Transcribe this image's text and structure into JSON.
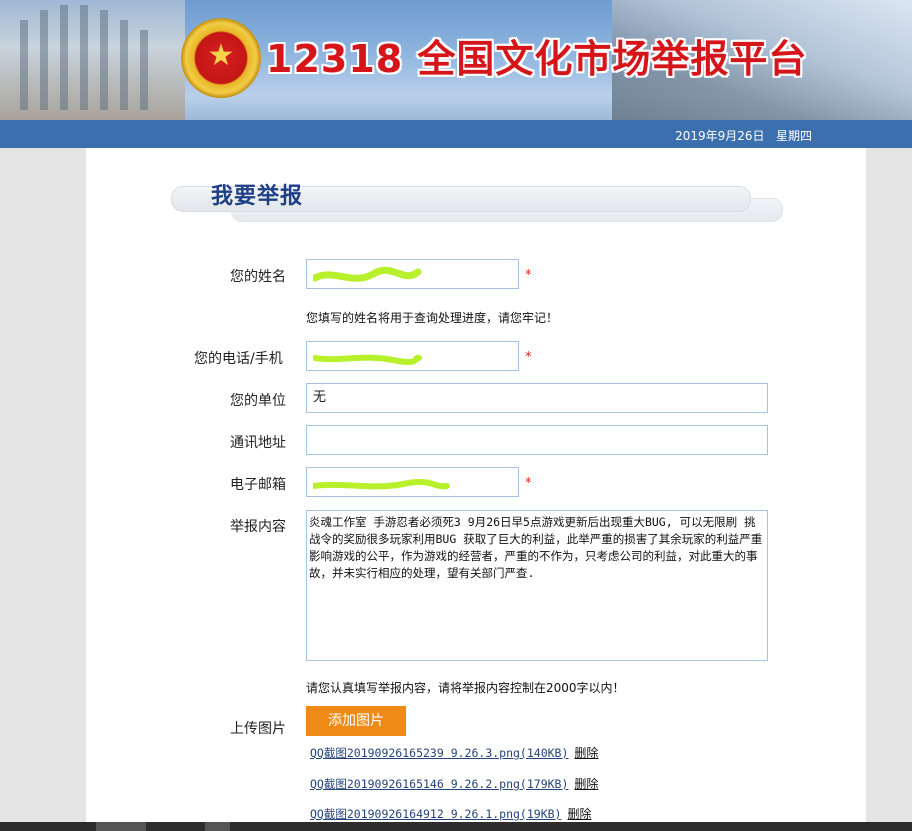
{
  "header": {
    "title": "12318 全国文化市场举报平台",
    "emblem_glyph": "★",
    "date": "2019年9月26日",
    "weekday": "星期四",
    "title_color": "#d5151a",
    "bar_color": "#3c6fae"
  },
  "form": {
    "heading": "我要举报",
    "name": {
      "label": "您的姓名",
      "required_mark": "*",
      "hint": "您填写的姓名将用于查询处理进度，请您牢记！"
    },
    "phone": {
      "label": "您的电话/手机",
      "required_mark": "*"
    },
    "unit": {
      "label": "您的单位",
      "value": "无"
    },
    "address": {
      "label": "通讯地址",
      "value": ""
    },
    "email": {
      "label": "电子邮箱",
      "required_mark": "*"
    },
    "report": {
      "label": "举报内容",
      "value": "炎魂工作室 手游忍者必须死3 9月26日早5点游戏更新后出现重大BUG, 可以无限刷 挑战令的奖励很多玩家利用BUG 获取了巨大的利益，此举严重的损害了其余玩家的利益严重影响游戏的公平，作为游戏的经营者，严重的不作为，只考虑公司的利益，对此重大的事故，并未实行相应的处理，望有关部门严查.",
      "hint": "请您认真填写举报内容，请将举报内容控制在2000字以内！"
    },
    "upload": {
      "label": "上传图片",
      "button": "添加图片",
      "button_color": "#f08a16",
      "files": [
        {
          "name": "QQ截图20190926165239 9.26.3.png(140KB)",
          "delete": "删除"
        },
        {
          "name": "QQ截图20190926165146 9.26.2.png(179KB)",
          "delete": "删除"
        },
        {
          "name": "QQ截图20190926164912 9.26.1.png(19KB)",
          "delete": "删除"
        }
      ]
    }
  }
}
